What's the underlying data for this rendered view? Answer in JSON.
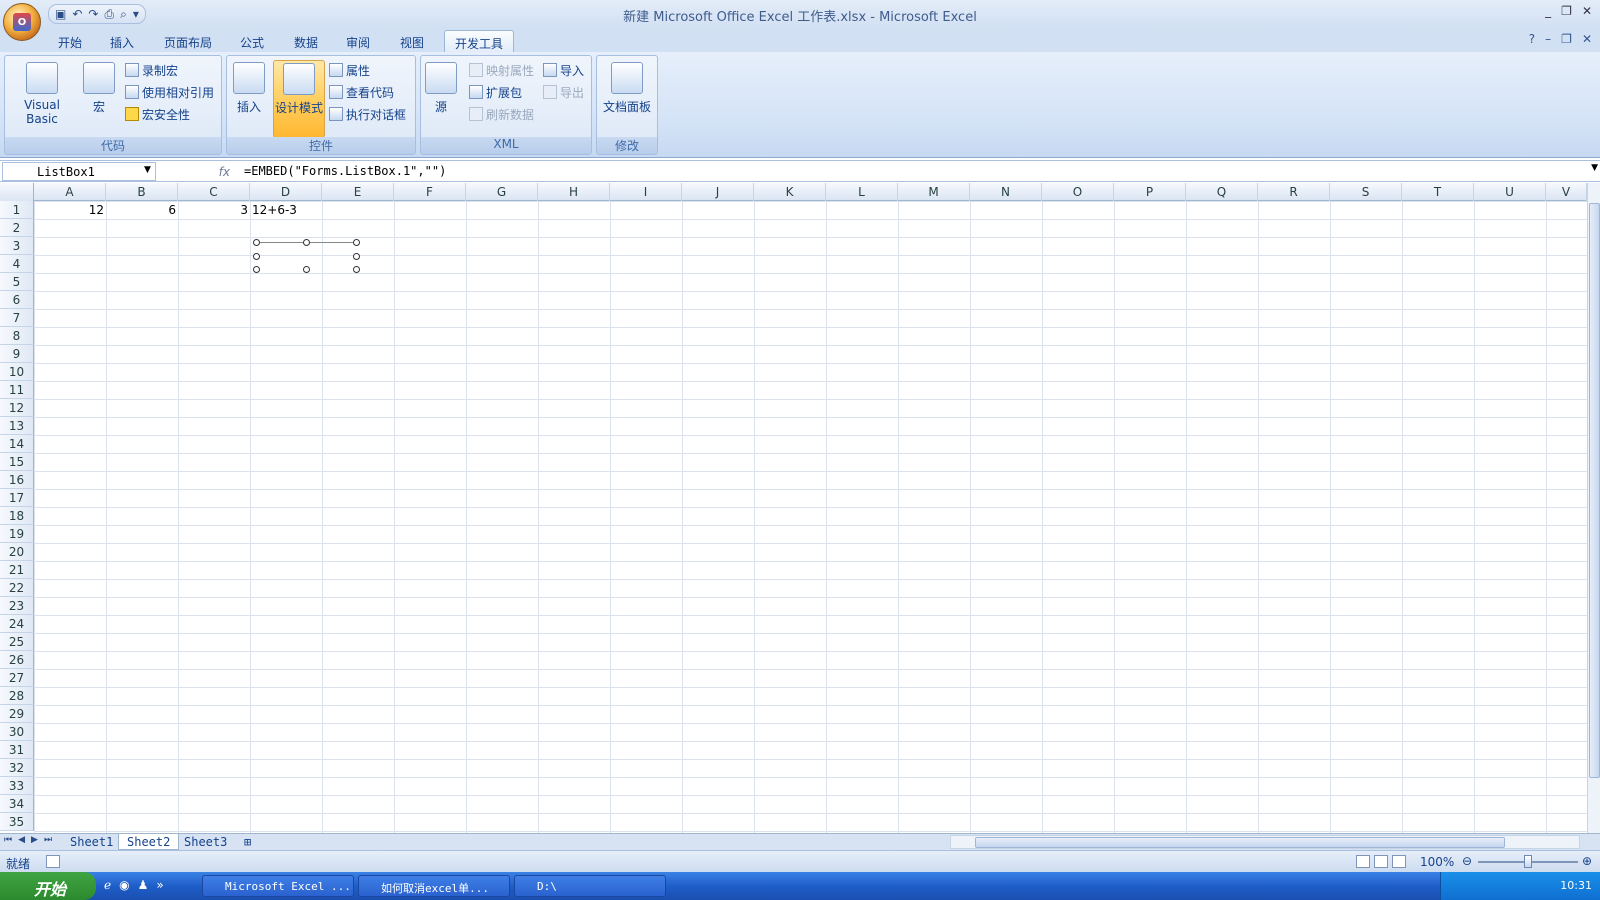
{
  "window": {
    "title": "新建 Microsoft Office Excel 工作表.xlsx - Microsoft Excel",
    "office_logo": "Office",
    "controls": [
      "_",
      "❐",
      "✕"
    ]
  },
  "qat": {
    "save_icon": "save-icon",
    "undo_icon": "undo-icon",
    "redo_icon": "redo-icon",
    "print_icon": "print-icon",
    "preview_icon": "print-preview-icon"
  },
  "tabs": [
    {
      "label": "开始"
    },
    {
      "label": "插入"
    },
    {
      "label": "页面布局"
    },
    {
      "label": "公式"
    },
    {
      "label": "数据"
    },
    {
      "label": "审阅"
    },
    {
      "label": "视图"
    },
    {
      "label": "开发工具",
      "active": true
    }
  ],
  "ribbon": {
    "code": {
      "label": "代码",
      "visual_basic": "Visual Basic",
      "macro": "宏",
      "record_macro": "录制宏",
      "relative_ref": "使用相对引用",
      "macro_security": "宏安全性"
    },
    "controls": {
      "label": "控件",
      "insert": "插入",
      "design_mode": "设计模式",
      "properties": "属性",
      "view_code": "查看代码",
      "run_dialog": "执行对话框"
    },
    "xml": {
      "label": "XML",
      "source": "源",
      "map_props": "映射属性",
      "expansion": "扩展包",
      "refresh": "刷新数据",
      "import": "导入",
      "export": "导出"
    },
    "modify": {
      "label": "修改",
      "doc_panel": "文档面板"
    }
  },
  "formula_bar": {
    "name_box": "ListBox1",
    "fx": "fx",
    "formula": "=EMBED(\"Forms.ListBox.1\",\"\")"
  },
  "columns": [
    "A",
    "B",
    "C",
    "D",
    "E",
    "F",
    "G",
    "H",
    "I",
    "J",
    "K",
    "L",
    "M",
    "N",
    "O",
    "P",
    "Q",
    "R",
    "S",
    "T",
    "U",
    "V"
  ],
  "rows": [
    "1",
    "2",
    "3",
    "4",
    "5",
    "6",
    "7",
    "8",
    "9",
    "10",
    "11",
    "12",
    "13",
    "14",
    "15",
    "16",
    "17",
    "18",
    "19",
    "20",
    "21",
    "22",
    "23",
    "24",
    "25",
    "26",
    "27",
    "28",
    "29",
    "30",
    "31",
    "32",
    "33",
    "34",
    "35"
  ],
  "cells": {
    "A1": "12",
    "B1": "6",
    "C1": "3",
    "D1": "12+6-3"
  },
  "sheets": [
    {
      "label": "Sheet1"
    },
    {
      "label": "Sheet2",
      "active": true
    },
    {
      "label": "Sheet3"
    }
  ],
  "status": {
    "ready": "就绪",
    "zoom": "100%"
  },
  "taskbar": {
    "start": "开始",
    "tasks": [
      {
        "label": "Microsoft Excel ..."
      },
      {
        "label": "如何取消excel单..."
      },
      {
        "label": "D:\\"
      }
    ],
    "clock": "10:31"
  }
}
